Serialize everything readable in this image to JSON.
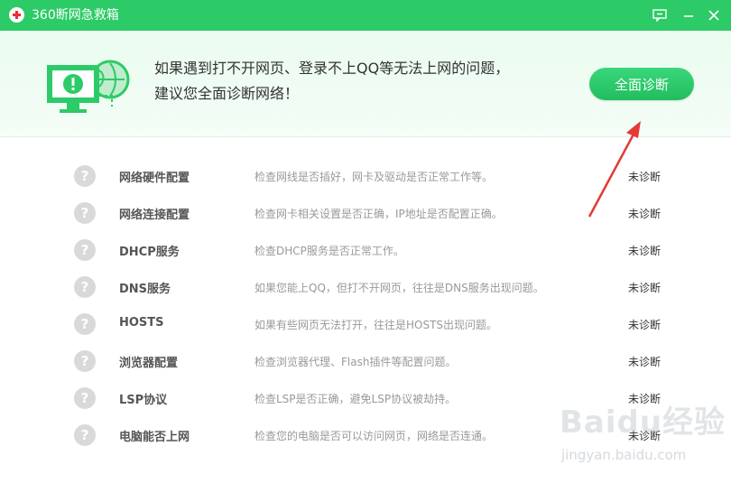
{
  "window": {
    "title": "360断网急救箱",
    "icons": {
      "logo": "red-cross-logo",
      "feedback": "feedback-icon",
      "minimize": "minimize-icon",
      "close": "close-icon"
    }
  },
  "header": {
    "line1": "如果遇到打不开网页、登录不上QQ等无法上网的问题，",
    "line2": "建议您全面诊断网络！",
    "diagnose_button": "全面诊断",
    "illustration_icon": "monitor-globe-warning-icon"
  },
  "items": [
    {
      "icon": "question-icon",
      "name": "网络硬件配置",
      "desc": "检查网线是否插好，网卡及驱动是否正常工作等。",
      "status": "未诊断"
    },
    {
      "icon": "question-icon",
      "name": "网络连接配置",
      "desc": "检查网卡相关设置是否正确，IP地址是否配置正确。",
      "status": "未诊断"
    },
    {
      "icon": "question-icon",
      "name": "DHCP服务",
      "desc": "检查DHCP服务是否正常工作。",
      "status": "未诊断"
    },
    {
      "icon": "question-icon",
      "name": "DNS服务",
      "desc": "如果您能上QQ，但打不开网页，往往是DNS服务出现问题。",
      "status": "未诊断"
    },
    {
      "icon": "question-icon",
      "name": "HOSTS",
      "desc": "如果有些网页无法打开，往往是HOSTS出现问题。",
      "status": "未诊断"
    },
    {
      "icon": "question-icon",
      "name": "浏览器配置",
      "desc": "检查浏览器代理、Flash插件等配置问题。",
      "status": "未诊断"
    },
    {
      "icon": "question-icon",
      "name": "LSP协议",
      "desc": "检查LSP是否正确，避免LSP协议被劫持。",
      "status": "未诊断"
    },
    {
      "icon": "question-icon",
      "name": "电脑能否上网",
      "desc": "检查您的电脑是否可以访问网页，网络是否连通。",
      "status": "未诊断"
    }
  ],
  "colors": {
    "titlebar": "#2ccb67",
    "button": "#27c565",
    "arrow": "#e53935",
    "question_circle": "#d9d9d9"
  },
  "watermark": {
    "brand": "Baidu经验",
    "url": "jingyan.baidu.com"
  }
}
